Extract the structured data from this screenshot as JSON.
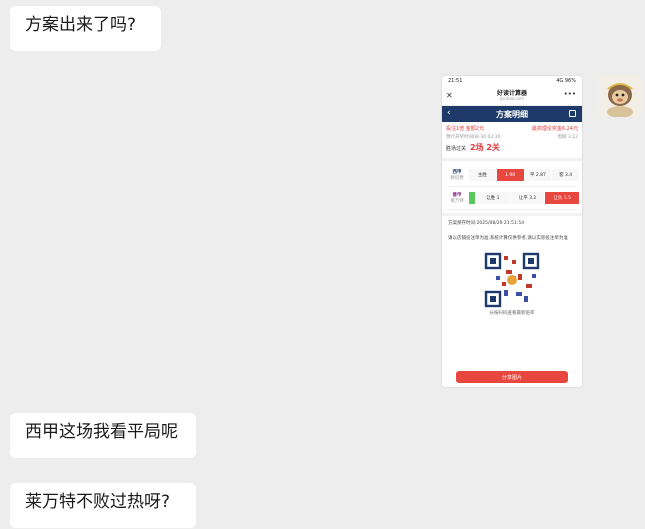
{
  "messages": [
    {
      "text": "方案出来了吗?",
      "side": "left"
    },
    {
      "text": "西甲这场我看平局呢",
      "side": "left"
    },
    {
      "text": "莱万特不败过热呀?",
      "side": "left"
    }
  ],
  "shared_image": {
    "status_time": "21:51",
    "status_right": "4G 96%",
    "app_title": "好读计算器",
    "app_domain": "jisuhao.com",
    "page_title": "方案明细",
    "plan_line": "投注1倍 金额2元",
    "prize_line": "最高理论奖金6.24元",
    "open_time": "预计开奖时间08-30 02:30",
    "issue": "周期 3.12",
    "pass_label": "胜场过关",
    "pass_value": "2场 2关",
    "match1": {
      "league": "西甲",
      "teams": "赫塔费",
      "cells": [
        "主胜",
        "1.98",
        "平 2.87",
        "客 3.4"
      ]
    },
    "match2": {
      "league": "意甲",
      "teams": "莱万特",
      "cells": [
        "让胜 1",
        "让平 3.2",
        "让负 1.5"
      ]
    },
    "save_time": "方案保存时间:2025/08/29 21:51:54",
    "note": "请以店铺投注单为准,系统计算仅供参考,请以实际投注单为准",
    "qr_caption": "长按扫码查看最新赔率",
    "share_button": "分享图片"
  },
  "colors": {
    "background": "#ededed",
    "bubble": "#ffffff",
    "nav": "#1d3a6b",
    "accent_red": "#e8473f"
  }
}
